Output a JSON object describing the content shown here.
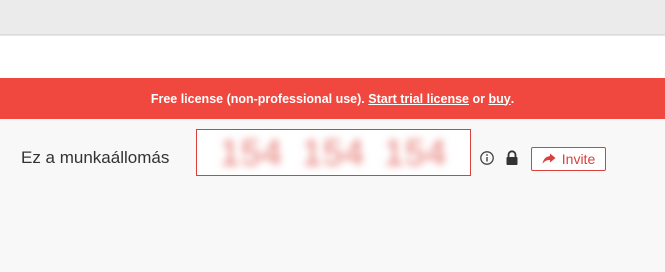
{
  "banner": {
    "prefix": "Free license (non-professional use). ",
    "trial_link": "Start trial license",
    "or_text": " or ",
    "buy_link": "buy",
    "suffix": "."
  },
  "workstation": {
    "label": "Ez a munkaállomás",
    "id_value": "154 154 154"
  },
  "actions": {
    "info_icon": "info-icon",
    "lock_icon": "lock-icon",
    "invite_icon": "share-arrow-icon",
    "invite_label": "Invite"
  },
  "colors": {
    "banner_bg": "#f0473f",
    "accent": "#d9413b"
  }
}
